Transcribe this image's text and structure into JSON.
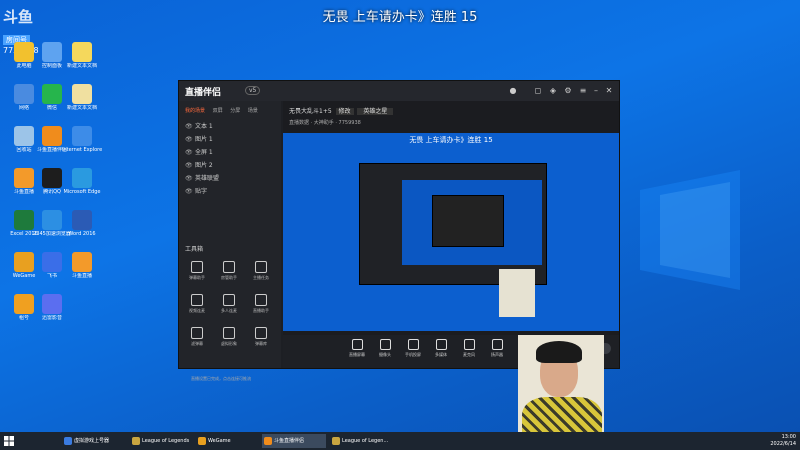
{
  "overlay_title": "无畏 上车请办卡》连胜 15",
  "logo_overlay": {
    "brand": "斗鱼",
    "tag": "房间号",
    "room": "7759938"
  },
  "desktop_icons": [
    {
      "label": "此电脑",
      "color": "#f2c12e"
    },
    {
      "label": "控制面板",
      "color": "#5ea3f0"
    },
    {
      "label": "新建文本文档",
      "color": "#f5d85c"
    },
    {
      "label": "网络",
      "color": "#4a8be0"
    },
    {
      "label": "微信",
      "color": "#26b54c"
    },
    {
      "label": "新建文本文档",
      "color": "#f0e0a0"
    },
    {
      "label": "回收站",
      "color": "#9cc4e8"
    },
    {
      "label": "斗鱼直播伴侣",
      "color": "#f08c1c"
    },
    {
      "label": "Internet Explorer",
      "color": "#3d8ce8"
    },
    {
      "label": "斗鱼直播",
      "color": "#f39a2a"
    },
    {
      "label": "腾讯QQ",
      "color": "#1d1d1d"
    },
    {
      "label": "Microsoft Edge",
      "color": "#2a9ae0"
    },
    {
      "label": "Excel 2016",
      "color": "#1e7a3c"
    },
    {
      "label": "2345加速浏览器",
      "color": "#2c8fe3"
    },
    {
      "label": "Word 2016",
      "color": "#2b5bb5"
    },
    {
      "label": "WeGame",
      "color": "#e8a020"
    },
    {
      "label": "飞书",
      "color": "#3a6ee8"
    },
    {
      "label": "斗鱼直播",
      "color": "#f39a2a"
    },
    {
      "label": "租号",
      "color": "#f0a020"
    },
    {
      "label": "迅雷影音",
      "color": "#5b6ef0"
    }
  ],
  "app": {
    "logo": "直播伴侣",
    "version": "v5",
    "scene_tabs": [
      "我的场景",
      "双屏",
      "分屏",
      "场景"
    ],
    "sources": [
      "文本 1",
      "图片 1",
      "全屏 1",
      "图片 2",
      "英雄联盟",
      "贴字"
    ],
    "tools_title": "工具箱",
    "tools": [
      "弹幕助手",
      "房管助手",
      "主播任务",
      "视频连麦",
      "多人连麦",
      "直播助手",
      "滤弹幕",
      "虚拟形象",
      "弹幕库"
    ],
    "notice": "直播设置已完成，点击连接可推流",
    "stream_title": "无畏大乱斗1+5",
    "stream_tag": "修改",
    "stream_category": "英雄之星",
    "stream_info2": "直播数据 · 大神助手 · 7759938",
    "preview_title": "无畏 上车请办卡》连胜 15",
    "controls": [
      "直播屏幕",
      "摄像头",
      "手机投屏",
      "多媒体",
      "麦克风",
      "扬声器"
    ],
    "start_label": "开始直播"
  },
  "taskbar": {
    "items": [
      {
        "label": "虚拟游戏上号器",
        "color": "#3a7be0"
      },
      {
        "label": "League of Legends",
        "color": "#c9a640"
      },
      {
        "label": "WeGame",
        "color": "#e8a020"
      },
      {
        "label": "斗鱼直播伴侣",
        "color": "#f08c1c"
      },
      {
        "label": "League of Legen...",
        "color": "#c9a640"
      }
    ],
    "time": "13:00",
    "date": "2022/6/14"
  }
}
